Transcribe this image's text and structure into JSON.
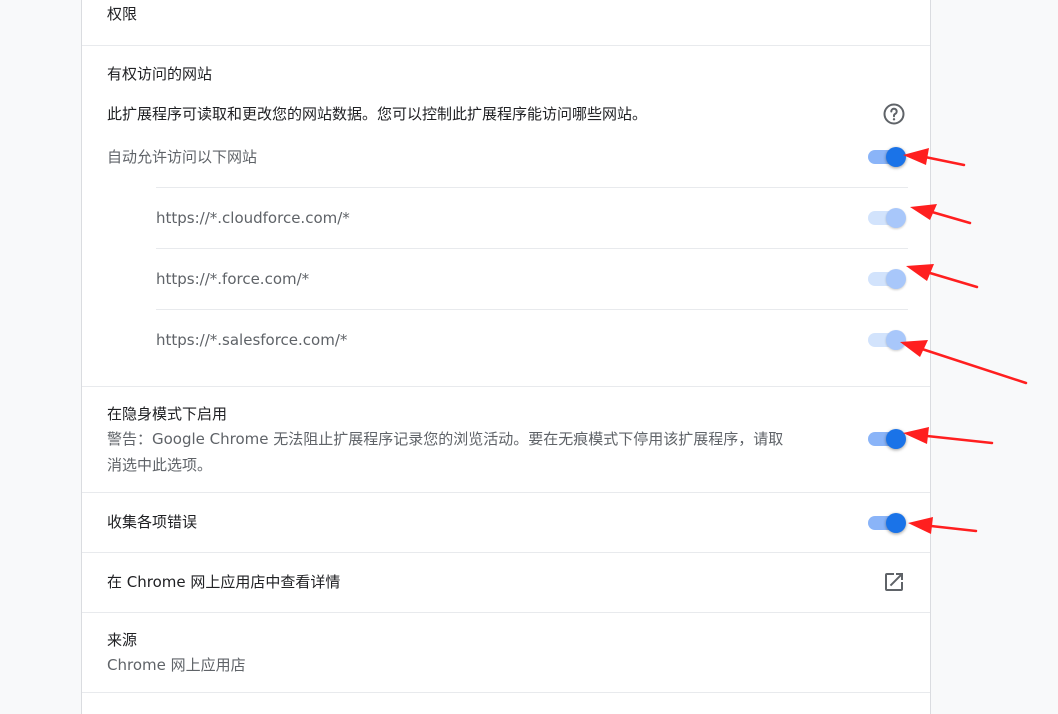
{
  "permissions": {
    "title": "权限"
  },
  "site_access": {
    "title": "有权访问的网站",
    "description": "此扩展程序可读取和更改您的网站数据。您可以控制此扩展程序能访问哪些网站。",
    "help_icon": "help-circle-icon",
    "auto_allow": {
      "label": "自动允许访问以下网站",
      "enabled": true
    },
    "sites": [
      {
        "url": "https://*.cloudforce.com/*",
        "enabled": true
      },
      {
        "url": "https://*.force.com/*",
        "enabled": true
      },
      {
        "url": "https://*.salesforce.com/*",
        "enabled": true
      }
    ]
  },
  "incognito": {
    "title": "在隐身模式下启用",
    "warning_line1": "警告：Google Chrome 无法阻止扩展程序记录您的浏览活动。要在无痕模式下停用该扩展程序，请取",
    "warning_line2": "消选中此选项。",
    "enabled": true
  },
  "collect_errors": {
    "label": "收集各项错误",
    "enabled": true
  },
  "webstore": {
    "label": "在 Chrome 网上应用店中查看详情",
    "icon": "open-in-new-icon"
  },
  "source": {
    "title": "来源",
    "value": "Chrome 网上应用店"
  },
  "colors": {
    "accent": "#1a73e8",
    "annotation_arrow": "#ff1f1f"
  }
}
